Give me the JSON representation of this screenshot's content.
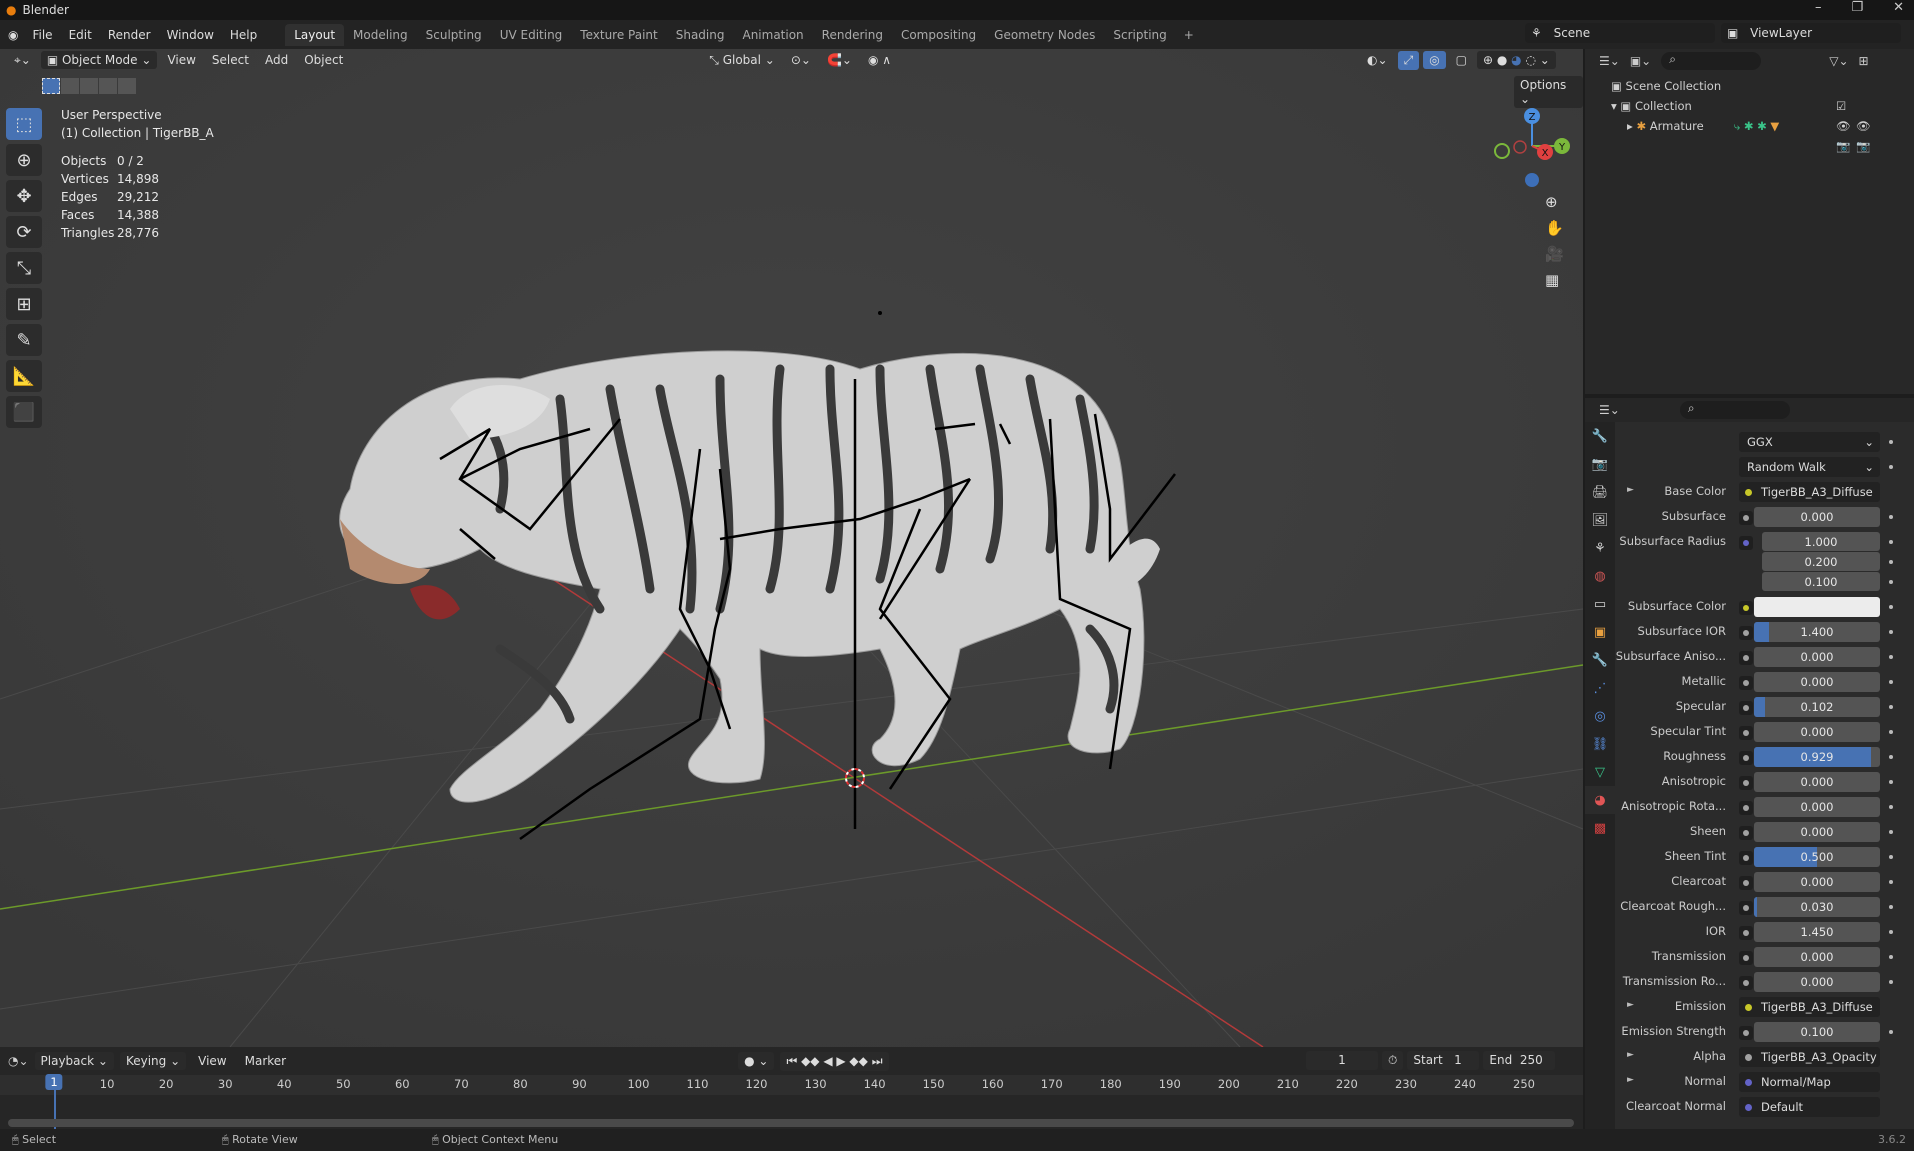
{
  "app": {
    "title": "Blender",
    "version": "3.6.2"
  },
  "menu": [
    "File",
    "Edit",
    "Render",
    "Window",
    "Help"
  ],
  "workspaces": [
    "Layout",
    "Modeling",
    "Sculpting",
    "UV Editing",
    "Texture Paint",
    "Shading",
    "Animation",
    "Rendering",
    "Compositing",
    "Geometry Nodes",
    "Scripting"
  ],
  "scene": {
    "name": "Scene",
    "view_layer": "ViewLayer"
  },
  "viewport": {
    "mode": "Object Mode",
    "menus": [
      "View",
      "Select",
      "Add",
      "Object"
    ],
    "orientation": "Global",
    "options": "Options",
    "view_name": "User Perspective",
    "collection_line": "(1) Collection | TigerBB_A",
    "stats": [
      {
        "k": "Objects",
        "v": "0 / 2"
      },
      {
        "k": "Vertices",
        "v": "14,898"
      },
      {
        "k": "Edges",
        "v": "29,212"
      },
      {
        "k": "Faces",
        "v": "14,388"
      },
      {
        "k": "Triangles",
        "v": "28,776"
      }
    ],
    "gizmo": {
      "z": "Z",
      "y": "Y",
      "x": "X"
    }
  },
  "outliner": {
    "items": [
      "Scene Collection",
      "Collection",
      "Armature"
    ]
  },
  "properties": {
    "rows": [
      {
        "t": "drop",
        "v": "GGX"
      },
      {
        "t": "drop",
        "v": "Random Walk"
      },
      {
        "t": "link",
        "l": "Base Color",
        "v": "TigerBB_A3_Diffuse",
        "c": "#c7c729",
        "arrow": true
      },
      {
        "t": "num",
        "l": "Subsurface",
        "v": "0.000",
        "f": 0
      },
      {
        "t": "num",
        "l": "Subsurface Radius",
        "v": "1.000",
        "f": 0,
        "sock": "#6363c7",
        "indent": true
      },
      {
        "t": "num",
        "l": "",
        "v": "0.200",
        "f": 0,
        "nosock": true,
        "indent": true
      },
      {
        "t": "num",
        "l": "",
        "v": "0.100",
        "f": 0,
        "nosock": true,
        "indent": true
      },
      {
        "t": "color",
        "l": "Subsurface Color",
        "c": "#c7c729"
      },
      {
        "t": "num",
        "l": "Subsurface IOR",
        "v": "1.400",
        "f": 0.12
      },
      {
        "t": "num",
        "l": "Subsurface Aniso...",
        "v": "0.000",
        "f": 0
      },
      {
        "t": "num",
        "l": "Metallic",
        "v": "0.000",
        "f": 0
      },
      {
        "t": "num",
        "l": "Specular",
        "v": "0.102",
        "f": 0.09
      },
      {
        "t": "num",
        "l": "Specular Tint",
        "v": "0.000",
        "f": 0
      },
      {
        "t": "num",
        "l": "Roughness",
        "v": "0.929",
        "f": 0.929
      },
      {
        "t": "num",
        "l": "Anisotropic",
        "v": "0.000",
        "f": 0
      },
      {
        "t": "num",
        "l": "Anisotropic Rota...",
        "v": "0.000",
        "f": 0
      },
      {
        "t": "num",
        "l": "Sheen",
        "v": "0.000",
        "f": 0
      },
      {
        "t": "num",
        "l": "Sheen Tint",
        "v": "0.500",
        "f": 0.5
      },
      {
        "t": "num",
        "l": "Clearcoat",
        "v": "0.000",
        "f": 0
      },
      {
        "t": "num",
        "l": "Clearcoat Rough...",
        "v": "0.030",
        "f": 0.02
      },
      {
        "t": "num",
        "l": "IOR",
        "v": "1.450",
        "f": 0
      },
      {
        "t": "num",
        "l": "Transmission",
        "v": "0.000",
        "f": 0
      },
      {
        "t": "num",
        "l": "Transmission Ro...",
        "v": "0.000",
        "f": 0
      },
      {
        "t": "link",
        "l": "Emission",
        "v": "TigerBB_A3_Diffuse",
        "c": "#c7c729",
        "arrow": true
      },
      {
        "t": "num",
        "l": "Emission Strength",
        "v": "0.100",
        "f": 0
      },
      {
        "t": "link",
        "l": "Alpha",
        "v": "TigerBB_A3_Opacity",
        "c": "#a1a1a1",
        "arrow": true
      },
      {
        "t": "link",
        "l": "Normal",
        "v": "Normal/Map",
        "c": "#6363c7",
        "arrow": true
      },
      {
        "t": "link",
        "l": "Clearcoat Normal",
        "v": "Default",
        "c": "#6363c7"
      }
    ]
  },
  "timeline": {
    "menus": [
      "Playback",
      "Keying",
      "View",
      "Marker"
    ],
    "current_frame": "1",
    "start_label": "Start",
    "start": "1",
    "end_label": "End",
    "end": "250",
    "ticks": [
      "1",
      "10",
      "20",
      "30",
      "40",
      "50",
      "60",
      "70",
      "80",
      "90",
      "100",
      "110",
      "120",
      "130",
      "140",
      "150",
      "160",
      "170",
      "180",
      "190",
      "200",
      "210",
      "220",
      "230",
      "240",
      "250"
    ]
  },
  "status": {
    "items": [
      "Select",
      "Rotate View",
      "Object Context Menu"
    ]
  }
}
